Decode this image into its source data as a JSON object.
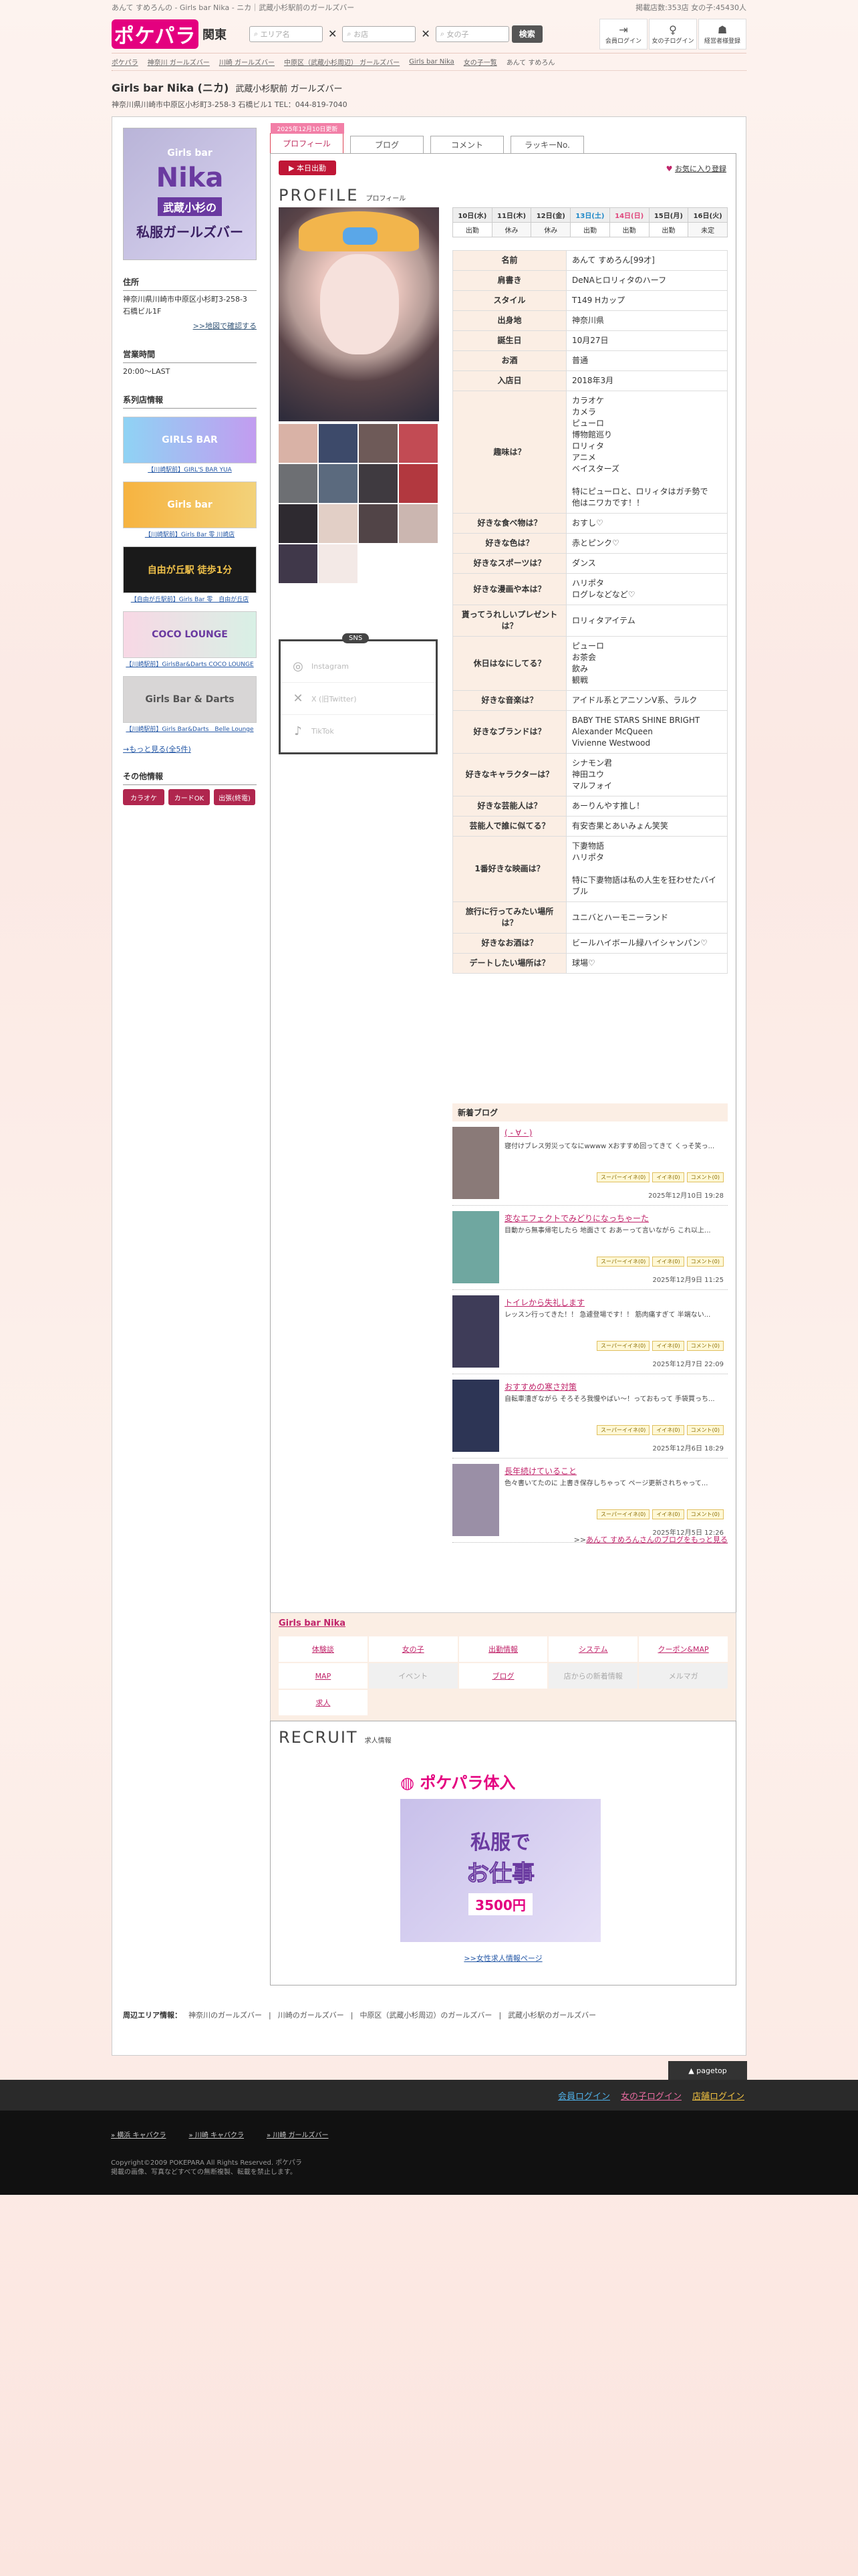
{
  "topbar": {
    "title": "あんて すめろんの - Girls bar Nika - ニカ｜武蔵小杉駅前のガールズバー",
    "counts": "掲載店数:353店  女の子:45430人"
  },
  "header": {
    "logo": "ポケパラ",
    "region": "関東",
    "search1": "エリア名",
    "search2": "お店",
    "search3": "女の子",
    "search_btn": "検索",
    "icons": [
      {
        "glyph": "⇥",
        "label": "会員ログイン"
      },
      {
        "glyph": "♀",
        "label": "女の子ログイン"
      },
      {
        "glyph": "☗",
        "label": "経営者様登録"
      }
    ]
  },
  "breadcrumb": [
    "ポケパラ",
    "神奈川 ガールズバー",
    "川崎 ガールズバー",
    "中原区（武蔵小杉周辺） ガールズバー",
    "Girls bar Nika",
    "女の子一覧",
    "あんて すめろん"
  ],
  "shop": {
    "name": "Girls bar Nika (ニカ)",
    "sub": "武蔵小杉駅前 ガールズバー",
    "address": "神奈川県川崎市中原区小杉町3-258-3 石橋ビル1 TEL：044-819-7040"
  },
  "left": {
    "banner": {
      "a": "Girls bar",
      "b": "Nika",
      "c": "武蔵小杉の",
      "d": "私服ガールズバー"
    },
    "addr_h": "住所",
    "addr": "神奈川県川崎市中原区小杉町3-258-3\n石橋ビル1F",
    "map_link": ">>地図で確認する",
    "hours_h": "営業時間",
    "hours": "20:00〜LAST",
    "group_h": "系列店情報",
    "groups": [
      {
        "label": "GIRLS BAR",
        "cap": "【川崎駅前】GIRL'S BAR YUA",
        "color": "#7fb8f0"
      },
      {
        "label": "Girls bar",
        "cap": "【川崎駅前】Girls Bar 零 川崎店",
        "color": "#f5a623"
      },
      {
        "label": "自由が丘駅 徒歩1分",
        "cap": "【自由が丘駅前】Girls Bar 零　自由が丘店",
        "color": "#222"
      },
      {
        "label": "COCO LOUNGE",
        "cap": "【川崎駅前】GirlsBar&Darts COCO LOUNGE",
        "color": "#c7e6d9"
      },
      {
        "label": "Girls Bar & Darts",
        "cap": "【川崎駅前】Girls Bar&Darts　Belle Lounge",
        "color": "#bbb"
      }
    ],
    "more": "→もっと見る(全5件)",
    "etc_h": "その他情報",
    "etc": [
      "カラオケ",
      "カードOK",
      "出張(終電)"
    ]
  },
  "tabs": [
    {
      "label": "プロフィール",
      "flag": "2025年12月10日更新"
    },
    {
      "label": "ブログ"
    },
    {
      "label": "コメント"
    },
    {
      "label": "ラッキーNo."
    }
  ],
  "panel": {
    "today": "▶ 本日出勤",
    "fav": "お気に入り登録",
    "title": "PROFILE",
    "title_sub": "プロフィール"
  },
  "schedule": {
    "days": [
      "10日(水)",
      "11日(木)",
      "12日(金)",
      "13日(土)",
      "14日(日)",
      "15日(月)",
      "16日(火)"
    ],
    "status": [
      "出勤",
      "休み",
      "休み",
      "出勤",
      "出勤",
      "出勤",
      "未定"
    ]
  },
  "profile": [
    {
      "k": "名前",
      "v": "あんて すめろん[99才]"
    },
    {
      "k": "肩書き",
      "v": "DeNAヒロリィタのハーフ"
    },
    {
      "k": "スタイル",
      "v": "T149 Hカップ"
    },
    {
      "k": "出身地",
      "v": "神奈川県"
    },
    {
      "k": "誕生日",
      "v": "10月27日"
    },
    {
      "k": "お酒",
      "v": "普通"
    },
    {
      "k": "入店日",
      "v": "2018年3月"
    },
    {
      "k": "趣味は？",
      "v": "カラオケ\nカメラ\nピューロ\n博物館巡り\nロリィタ\nアニメ\nベイスターズ\n\n特にピューロと、ロリィタはガチ勢で\n他はニワカです！！"
    },
    {
      "k": "好きな食べ物は？",
      "v": "おすし♡"
    },
    {
      "k": "好きな色は？",
      "v": "赤とピンク♡"
    },
    {
      "k": "好きなスポーツは？",
      "v": "ダンス"
    },
    {
      "k": "好きな漫画や本は？",
      "v": "ハリポタ\nログレなどなど♡"
    },
    {
      "k": "貰ってうれしいプレゼントは？",
      "v": "ロリィタアイテム"
    },
    {
      "k": "休日はなにしてる？",
      "v": "ピューロ\nお茶会\n飲み\n観戦"
    },
    {
      "k": "好きな音楽は？",
      "v": "アイドル系とアニソンV系、ラルク"
    },
    {
      "k": "好きなブランドは？",
      "v": "BABY THE STARS SHINE BRIGHT\nAlexander McQueen\nVivienne Westwood"
    },
    {
      "k": "好きなキャラクターは？",
      "v": "シナモン君\n神田ユウ\nマルフォイ"
    },
    {
      "k": "好きな芸能人は？",
      "v": "あーりんやす推し！"
    },
    {
      "k": "芸能人で誰に似てる？",
      "v": "有安杏果とあいみょん笑笑"
    },
    {
      "k": "1番好きな映画は？",
      "v": "下妻物語\nハリポタ\n\n特に下妻物語は私の人生を狂わせたバイブル"
    },
    {
      "k": "旅行に行ってみたい場所は？",
      "v": "ユニバとハーモニーランド"
    },
    {
      "k": "好きなお酒は？",
      "v": "ビールハイボール緑ハイシャンパン♡"
    },
    {
      "k": "デートしたい場所は？",
      "v": "球場♡"
    }
  ],
  "sns": {
    "head": "SNS",
    "items": [
      {
        "glyph": "◎",
        "label": "Instagram"
      },
      {
        "glyph": "✕",
        "label": "X (旧Twitter)"
      },
      {
        "glyph": "♪",
        "label": "TikTok"
      }
    ]
  },
  "blog": {
    "head": "新着ブログ",
    "tags": [
      "スーパーイイネ(0)",
      "イイネ(0)",
      "コメント(0)"
    ],
    "items": [
      {
        "title": "( - ∀ - )",
        "text": "寝付けブレス労災ってなにwwww Xおすすめ回ってきて くっそ笑っ...",
        "date": "2025年12月10日 19:28"
      },
      {
        "title": "変なエフェクトでみどりになっちゃーた",
        "text": "目動から無事帰宅したら 地面さて おあーって言いながら これ以上...",
        "date": "2025年12月9日 11:25"
      },
      {
        "title": "トイレから失礼します",
        "text": "レッスン行ってきた！！ 急遽登場です！！ 筋肉痛すぎて 半端ない...",
        "date": "2025年12月7日 22:09"
      },
      {
        "title": "おすすめの寒さ対策",
        "text": "自転車漕ぎながら そろそろ我慢やばい〜！っておもって 手袋買っち...",
        "date": "2025年12月6日 18:29"
      },
      {
        "title": "長年続けていること",
        "text": "色々書いてたのに 上書き保存しちゃって ページ更新されちゃって...",
        "date": "2025年12月5日 12:26"
      }
    ],
    "more_pre": ">>",
    "more": "あんて すめろんさんのブログをもっと見る"
  },
  "shopnav": {
    "head": "Girls bar Nika",
    "items": [
      {
        "l": "体験談",
        "d": false
      },
      {
        "l": "女の子",
        "d": false
      },
      {
        "l": "出勤情報",
        "d": false
      },
      {
        "l": "システム",
        "d": false
      },
      {
        "l": "クーポン&MAP",
        "d": false
      },
      {
        "l": "MAP",
        "d": false
      },
      {
        "l": "イベント",
        "d": true
      },
      {
        "l": "ブログ",
        "d": false
      },
      {
        "l": "店からの新着情報",
        "d": true
      },
      {
        "l": "メルマガ",
        "d": true
      },
      {
        "l": "求人",
        "d": false
      }
    ]
  },
  "recruit": {
    "title": "RECRUIT",
    "sub": "求人情報",
    "logo": "ポケパラ体入",
    "b1": "私服で",
    "b2": "お仕事",
    "b3": "3500円",
    "link": ">>女性求人情報ページ"
  },
  "area": {
    "head": "周辺エリア情報：",
    "items": [
      "神奈川のガールズバー",
      "川崎のガールズバー",
      "中原区（武蔵小杉周辺）のガールズバー",
      "武蔵小杉駅のガールズバー"
    ]
  },
  "footer": {
    "pagetop": "▲ pagetop",
    "logins": [
      "会員ログイン",
      "女の子ログイン",
      "店舗ログイン"
    ],
    "links": [
      "横浜 キャバクラ",
      "川崎 キャバクラ",
      "川崎 ガールズバー"
    ],
    "copyright": "Copyright©2009 POKEPARA All Rights Reserved. ポケパラ\n掲載の画像、写真などすべての無断複製、転載を禁止します。"
  }
}
